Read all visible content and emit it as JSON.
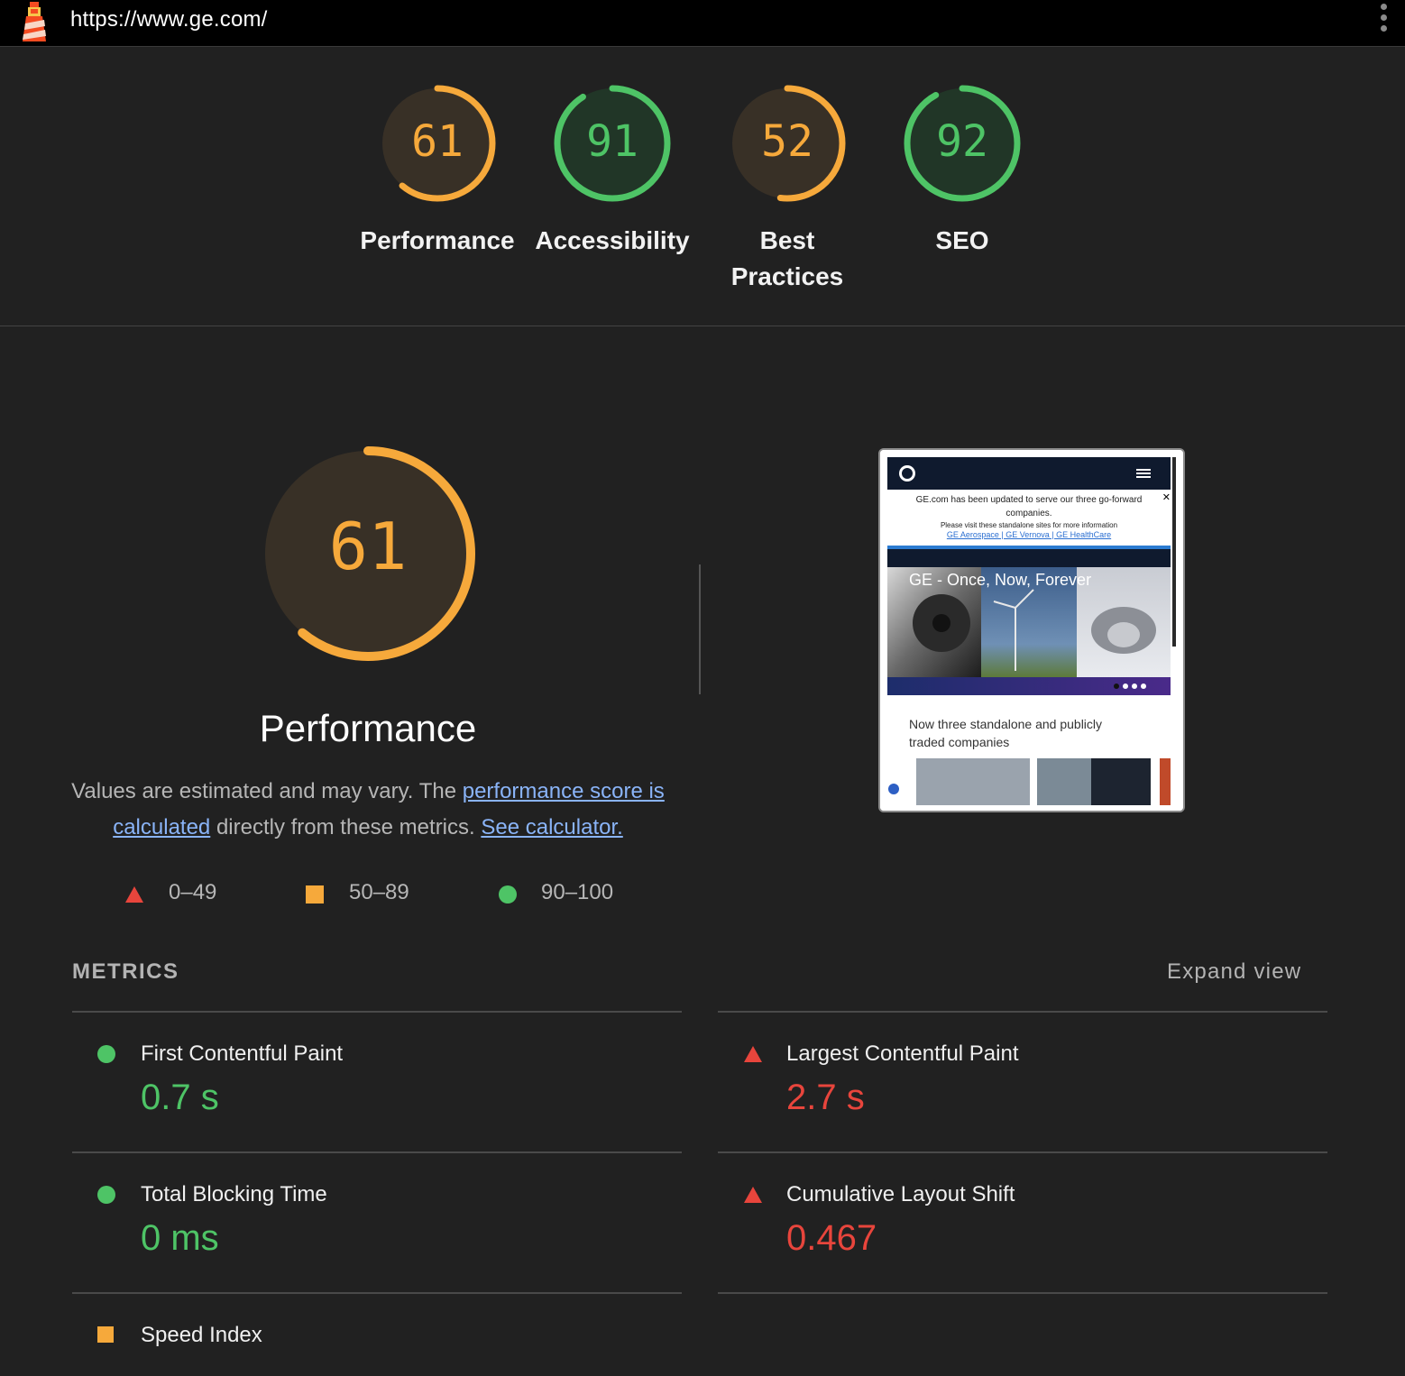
{
  "header": {
    "url": "https://www.ge.com/",
    "logo_icon": "lighthouse-icon",
    "menu_icon": "kebab-menu-icon"
  },
  "colors": {
    "pass": "#0cce6b",
    "average": "#ffa400",
    "fail": "#ff4e42",
    "gauge_green": "#4ec466",
    "gauge_orange": "#f6a93b",
    "metric_red": "#e8453c"
  },
  "scores": [
    {
      "label": "Performance",
      "score": 61,
      "rating": "average"
    },
    {
      "label": "Accessibility",
      "score": 91,
      "rating": "pass"
    },
    {
      "label": "Best Practices",
      "score": 52,
      "rating": "average"
    },
    {
      "label": "SEO",
      "score": 92,
      "rating": "pass"
    }
  ],
  "performance": {
    "title": "Performance",
    "score": 61,
    "desc_text_1": "Values are estimated and may vary. The ",
    "desc_link_1": "performance score is calculated",
    "desc_text_2": " directly from these metrics. ",
    "desc_link_2": "See calculator."
  },
  "legend": [
    {
      "range": "0–49",
      "shape": "triangle-icon"
    },
    {
      "range": "50–89",
      "shape": "square-icon"
    },
    {
      "range": "90–100",
      "shape": "circle-icon"
    }
  ],
  "screenshot": {
    "banner_line1": "GE.com has been updated to serve our three go-forward",
    "banner_line2": "companies.",
    "banner_line3": "Please visit these standalone sites for more information",
    "banner_links": "GE Aerospace | GE Vernova | GE HealthCare",
    "hero_title": "GE - Once, Now, Forever",
    "body_line1": "Now three standalone and publicly",
    "body_line2": "traded companies"
  },
  "metrics": {
    "header": "METRICS",
    "expand_label": "Expand view",
    "items": [
      {
        "name": "First Contentful Paint",
        "value": "0.7 s",
        "rating": "pass"
      },
      {
        "name": "Largest Contentful Paint",
        "value": "2.7 s",
        "rating": "fail"
      },
      {
        "name": "Total Blocking Time",
        "value": "0 ms",
        "rating": "pass"
      },
      {
        "name": "Cumulative Layout Shift",
        "value": "0.467",
        "rating": "fail"
      },
      {
        "name": "Speed Index",
        "value": "",
        "rating": "average"
      }
    ]
  }
}
